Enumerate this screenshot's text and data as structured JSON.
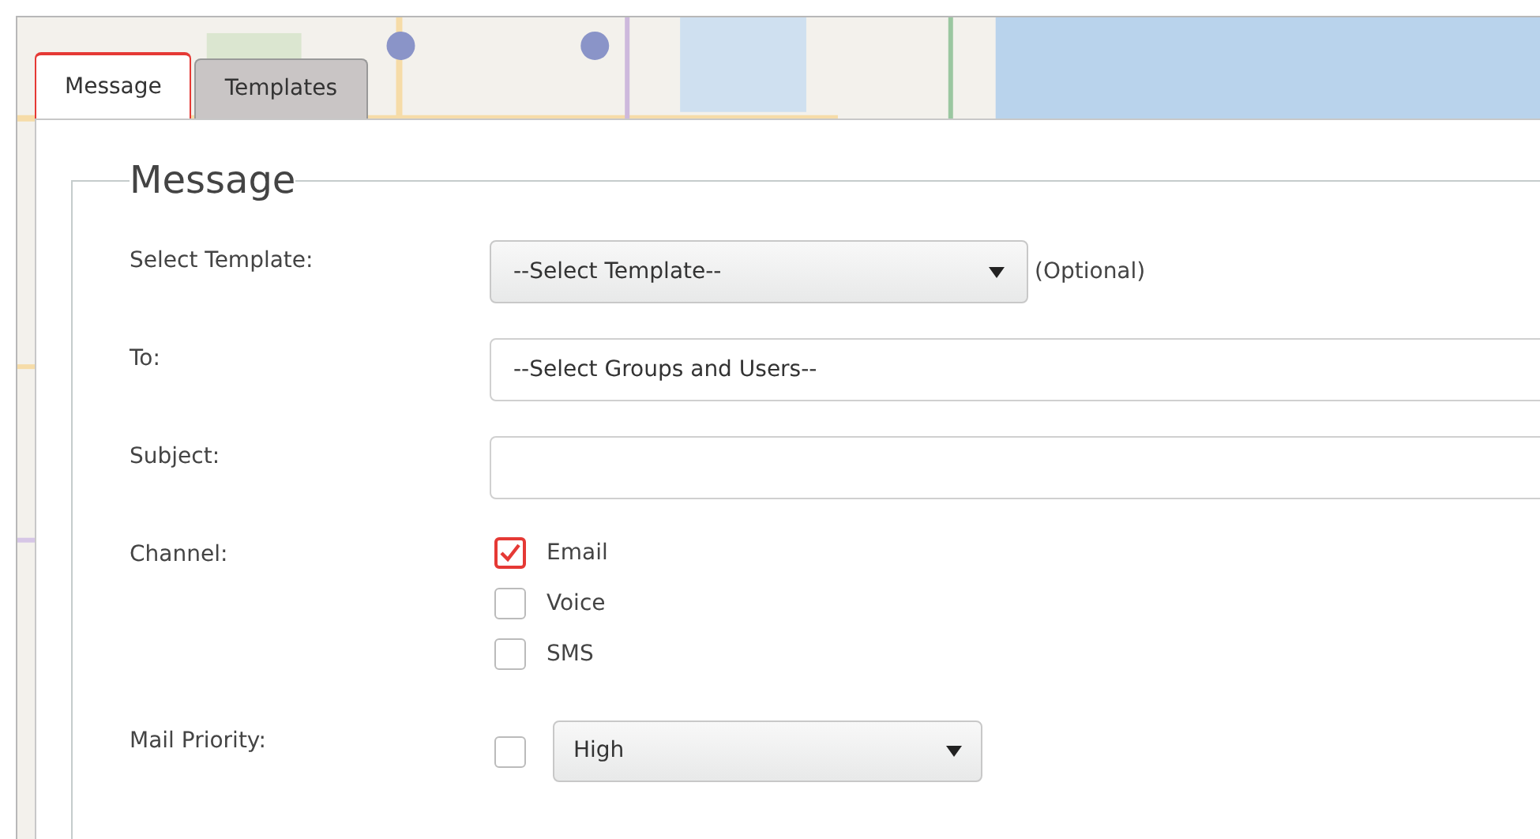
{
  "tabs": [
    {
      "label": "Message",
      "selected": true
    },
    {
      "label": "Templates",
      "selected": false
    }
  ],
  "form": {
    "legend": "Message",
    "template": {
      "label": "Select Template:",
      "value": "--Select Template--",
      "note": "(Optional)"
    },
    "to": {
      "label": "To:",
      "placeholder": "--Select Groups and Users--"
    },
    "subject": {
      "label": "Subject:"
    },
    "channel": {
      "label": "Channel:",
      "options": [
        {
          "label": "Email",
          "checked": true
        },
        {
          "label": "Voice",
          "checked": false
        },
        {
          "label": "SMS",
          "checked": false
        }
      ]
    },
    "mail_priority": {
      "label": "Mail Priority:",
      "checked": false,
      "value": "High"
    }
  }
}
